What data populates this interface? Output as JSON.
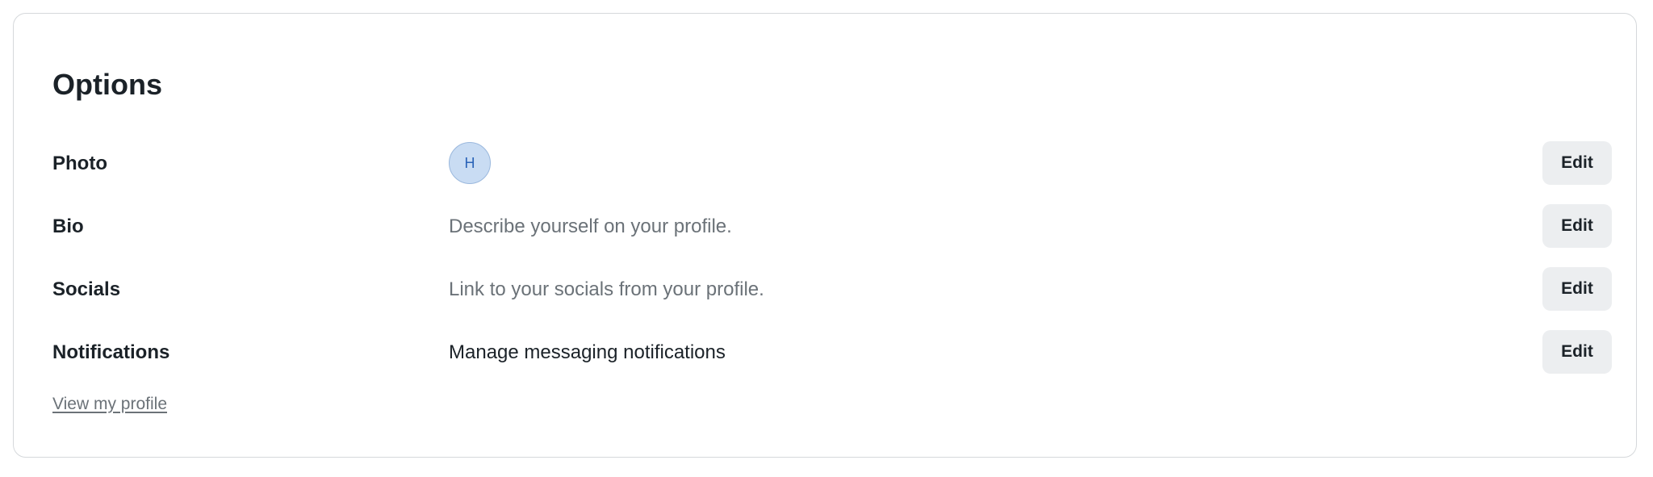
{
  "options": {
    "title": "Options",
    "photo": {
      "label": "Photo",
      "avatar_initial": "H",
      "edit_label": "Edit"
    },
    "bio": {
      "label": "Bio",
      "placeholder": "Describe yourself on your profile.",
      "edit_label": "Edit"
    },
    "socials": {
      "label": "Socials",
      "placeholder": "Link to your socials from your profile.",
      "edit_label": "Edit"
    },
    "notifications": {
      "label": "Notifications",
      "value": "Manage messaging notifications",
      "edit_label": "Edit"
    },
    "view_profile_link": "View my profile"
  },
  "colors": {
    "avatar_bg": "#c9dcf3",
    "avatar_text": "#2a63b8",
    "button_bg": "#eceef0",
    "muted_text": "#6b7278",
    "primary_text": "#1b2228"
  }
}
